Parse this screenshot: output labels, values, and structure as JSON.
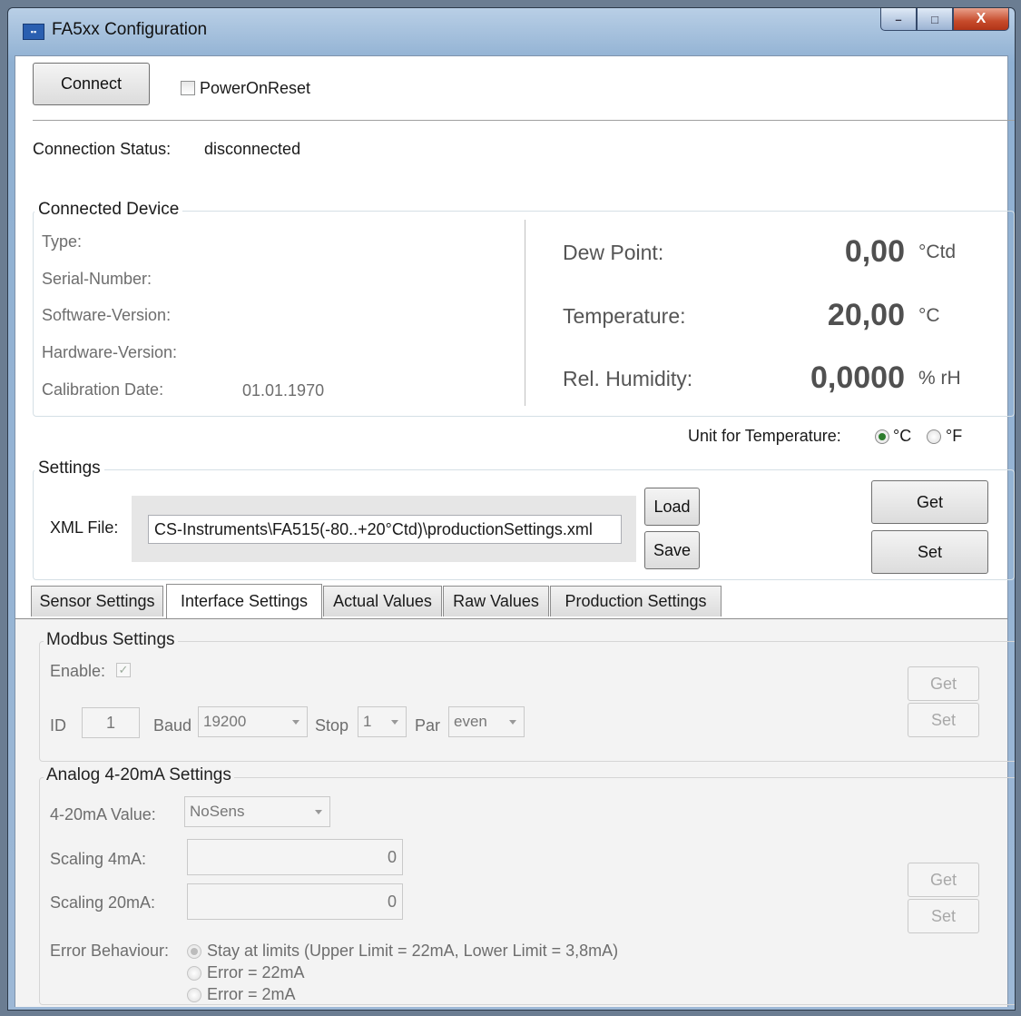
{
  "window": {
    "title": "FA5xx Configuration",
    "icon": "app-icon",
    "controls": {
      "minimize": "–",
      "maximize": "□",
      "close": "X"
    }
  },
  "top": {
    "connect_label": "Connect",
    "power_on_reset_label": "PowerOnReset",
    "power_on_reset_checked": false
  },
  "status": {
    "label": "Connection Status:",
    "value": "disconnected"
  },
  "device": {
    "group_label": "Connected Device",
    "fields": [
      {
        "label": "Type:",
        "value": ""
      },
      {
        "label": "Serial-Number:",
        "value": ""
      },
      {
        "label": "Software-Version:",
        "value": ""
      },
      {
        "label": "Hardware-Version:",
        "value": ""
      },
      {
        "label": "Calibration Date:",
        "value": "01.01.1970"
      }
    ],
    "measurements": [
      {
        "label": "Dew Point:",
        "value": "0,00",
        "unit": "°Ctd"
      },
      {
        "label": "Temperature:",
        "value": "20,00",
        "unit": "°C"
      },
      {
        "label": "Rel. Humidity:",
        "value": "0,0000",
        "unit": "% rH"
      }
    ]
  },
  "unit_temp": {
    "label": "Unit for Temperature:",
    "celsius": "°C",
    "fahrenheit": "°F",
    "selected": "°C"
  },
  "settings": {
    "group_label": "Settings",
    "xml_label": "XML File:",
    "xml_value": "CS-Instruments\\FA515(-80..+20°Ctd)\\productionSettings.xml",
    "load_label": "Load",
    "save_label": "Save",
    "get_label": "Get",
    "set_label": "Set"
  },
  "tabs": [
    "Sensor Settings",
    "Interface Settings",
    "Actual Values",
    "Raw Values",
    "Production Settings"
  ],
  "active_tab": "Interface Settings",
  "modbus": {
    "group_label": "Modbus Settings",
    "enable_label": "Enable:",
    "enable_checked": true,
    "id_label": "ID",
    "id_value": "1",
    "baud_label": "Baud",
    "baud_value": "19200",
    "stop_label": "Stop",
    "stop_value": "1",
    "par_label": "Par",
    "par_value": "even",
    "get_label": "Get",
    "set_label": "Set"
  },
  "analog": {
    "group_label": "Analog 4-20mA Settings",
    "value_label": "4-20mA Value:",
    "value_selected": "NoSens",
    "scaling4_label": "Scaling 4mA:",
    "scaling4_value": "0",
    "scaling20_label": "Scaling 20mA:",
    "scaling20_value": "0",
    "error_label": "Error Behaviour:",
    "error_options": [
      "Stay at limits (Upper Limit = 22mA, Lower Limit = 3,8mA)",
      "Error = 22mA",
      "Error = 2mA"
    ],
    "error_selected": "Stay at limits (Upper Limit = 22mA, Lower Limit = 3,8mA)",
    "get_label": "Get",
    "set_label": "Set"
  }
}
